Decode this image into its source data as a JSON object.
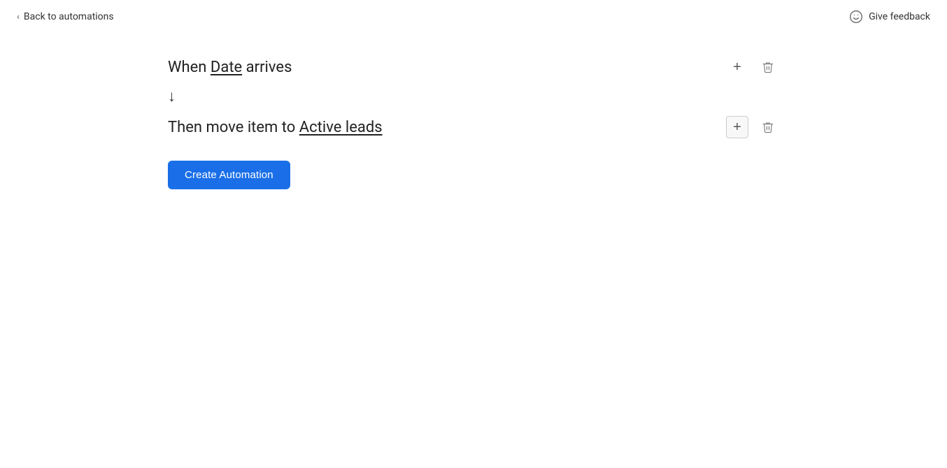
{
  "nav": {
    "back_label": "Back to automations",
    "give_feedback_label": "Give feedback"
  },
  "trigger": {
    "prefix": "When ",
    "link": "Date",
    "suffix": " arrives",
    "add_button_label": "+",
    "delete_button_label": "delete"
  },
  "action": {
    "prefix": "Then move item to ",
    "link": "Active leads",
    "add_button_label": "+",
    "delete_button_label": "delete"
  },
  "create_button": {
    "label": "Create Automation"
  },
  "colors": {
    "blue": "#1a6fe8",
    "text_dark": "#222222",
    "text_mid": "#555555",
    "border": "#cccccc"
  }
}
